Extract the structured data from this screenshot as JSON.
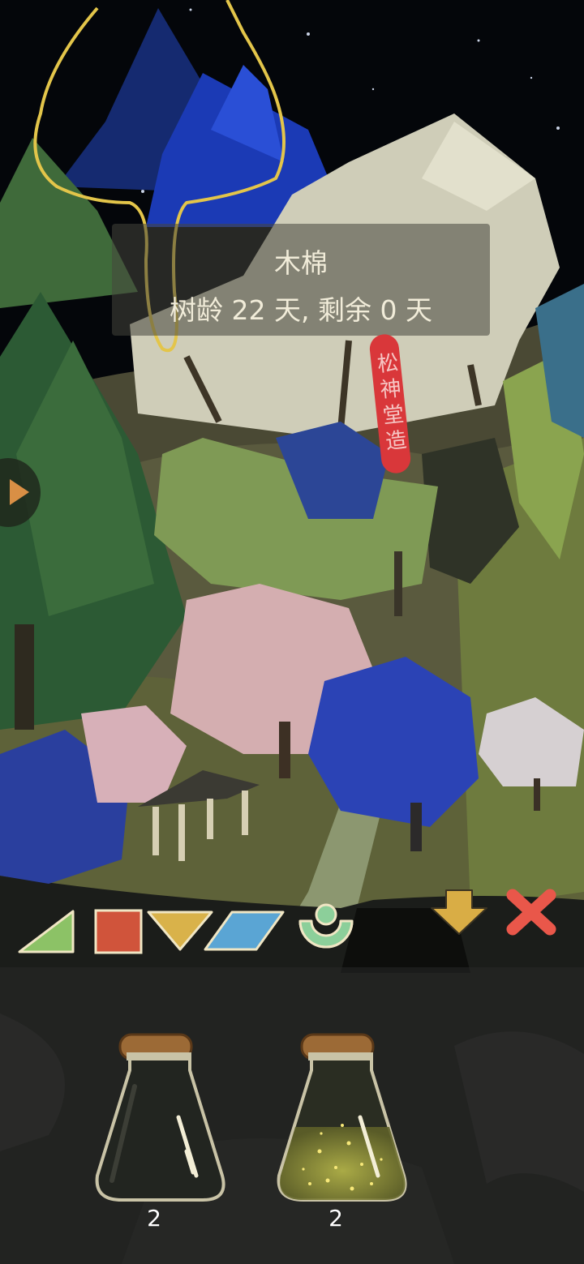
{
  "tree_info": {
    "name": "木棉",
    "details": "树龄 22 天, 剩余 0 天"
  },
  "seal": {
    "text": "松神堂造"
  },
  "side_panel": {
    "icon": "play-triangle-icon"
  },
  "toolbar": {
    "tools": [
      {
        "name": "triangle-shape",
        "color": "#8cc266"
      },
      {
        "name": "square-shape",
        "color": "#d0543b"
      },
      {
        "name": "inverted-triangle-shape",
        "color": "#d9b24a"
      },
      {
        "name": "parallelogram-shape",
        "color": "#5aa5d4"
      },
      {
        "name": "seed-shape",
        "color": "#8ccf9a"
      }
    ],
    "download_icon": "down-arrow-icon",
    "close_icon": "close-x-icon",
    "download_color": "#d9ad45",
    "close_color": "#e9574a"
  },
  "inventory": {
    "items": [
      {
        "name": "empty-potion",
        "count": "2"
      },
      {
        "name": "star-potion",
        "count": "2"
      }
    ]
  }
}
